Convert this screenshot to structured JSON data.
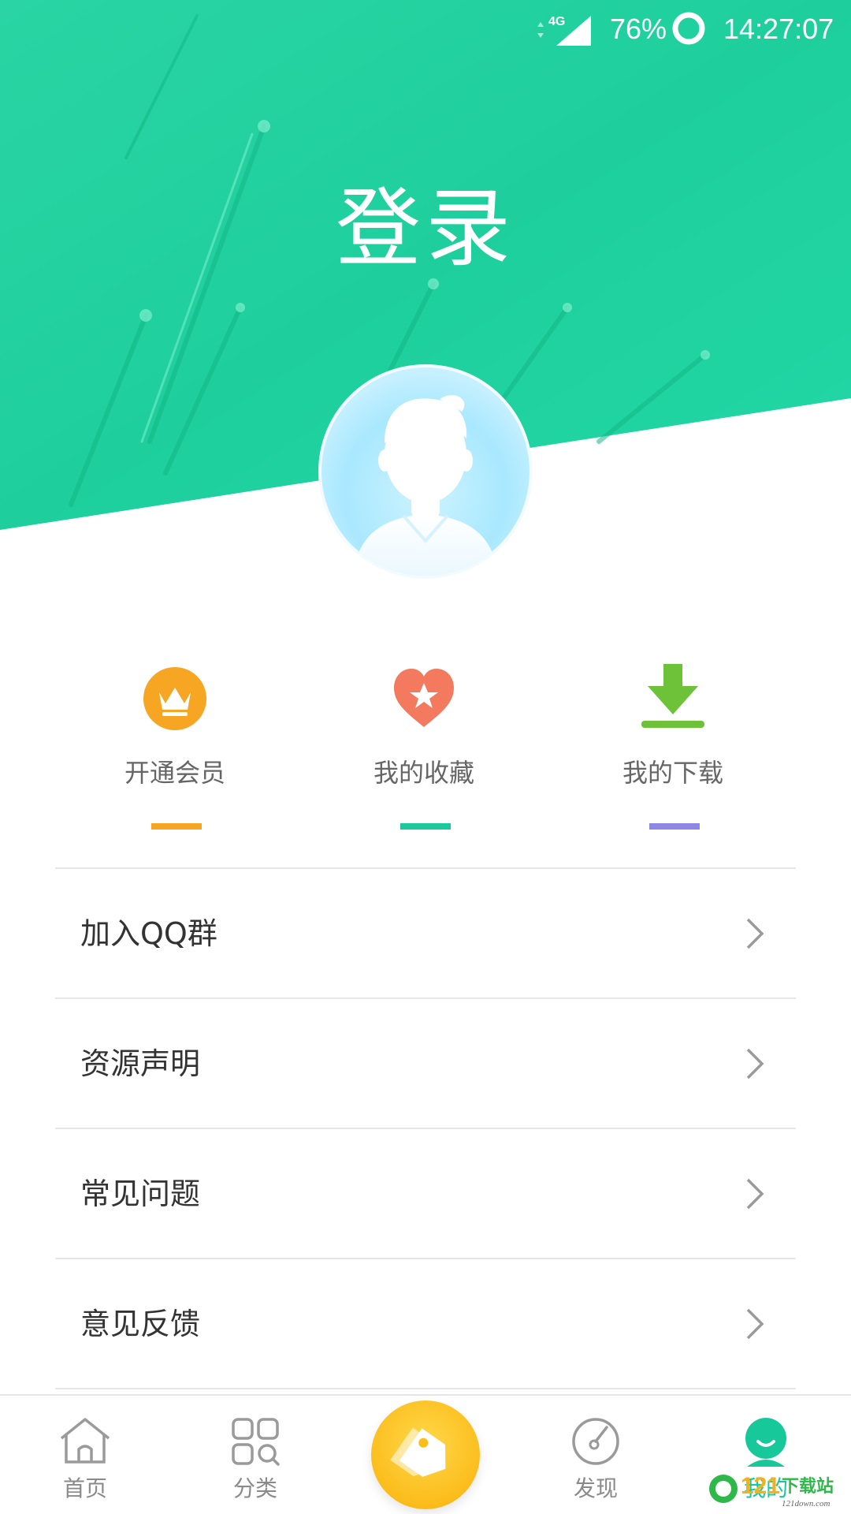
{
  "status_bar": {
    "network": "4G",
    "battery": "76%",
    "time": "14:27:07"
  },
  "header": {
    "title": "登录",
    "accent_color": "#1ed3a0"
  },
  "quick_actions": [
    {
      "label": "开通会员",
      "icon": "crown-icon",
      "color": "#f6a623"
    },
    {
      "label": "我的收藏",
      "icon": "heart-star-icon",
      "color": "#1dc99a"
    },
    {
      "label": "我的下载",
      "icon": "download-icon",
      "color": "#8f86e6"
    }
  ],
  "menu": [
    {
      "label": "加入QQ群"
    },
    {
      "label": "资源声明"
    },
    {
      "label": "常见问题"
    },
    {
      "label": "意见反馈"
    }
  ],
  "bottom_nav": {
    "home": {
      "label": "首页",
      "icon": "home-icon"
    },
    "category": {
      "label": "分类",
      "icon": "grid-search-icon"
    },
    "center": {
      "icon": "tag-icon"
    },
    "discover": {
      "label": "发现",
      "icon": "compass-icon"
    },
    "mine": {
      "label": "我的",
      "icon": "user-face-icon",
      "active": true
    }
  },
  "watermark": {
    "brand": "121下载站",
    "url": "121down.com"
  }
}
